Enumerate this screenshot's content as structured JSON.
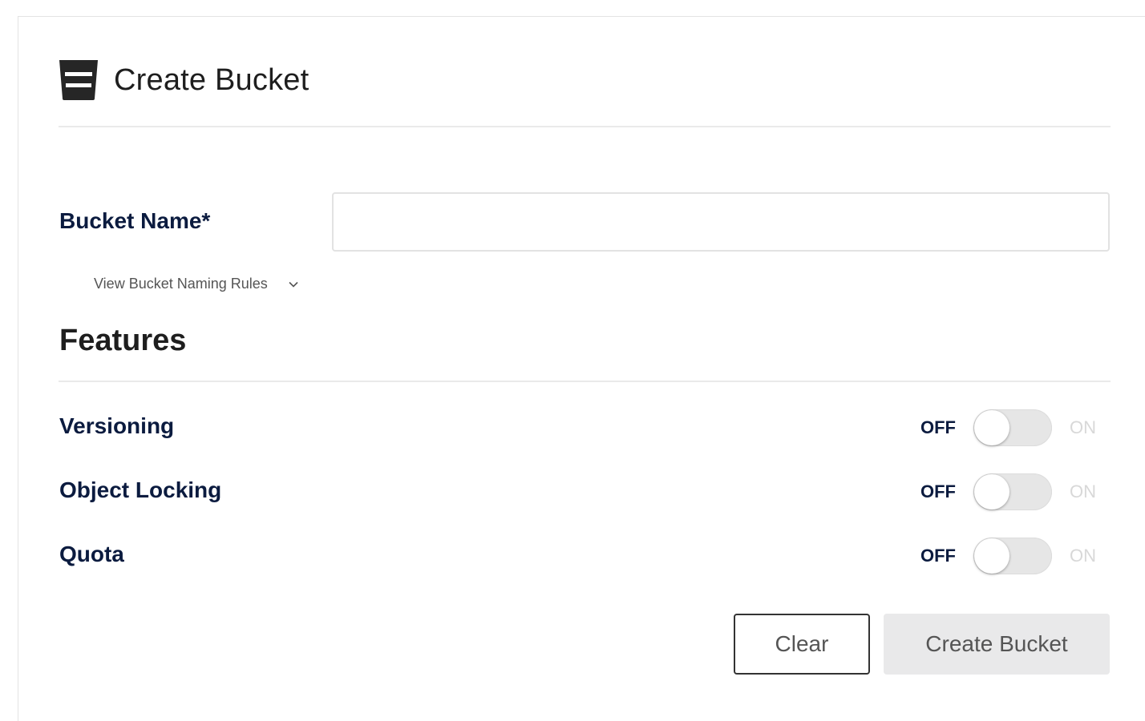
{
  "header": {
    "title": "Create Bucket",
    "icon": "bucket-icon"
  },
  "bucket_name": {
    "label": "Bucket Name*",
    "value": "",
    "placeholder": ""
  },
  "naming_rules": {
    "label": "View Bucket Naming Rules",
    "icon": "chevron-down-icon"
  },
  "features": {
    "title": "Features",
    "items": [
      {
        "label": "Versioning",
        "state": "OFF",
        "off_label": "OFF",
        "on_label": "ON"
      },
      {
        "label": "Object Locking",
        "state": "OFF",
        "off_label": "OFF",
        "on_label": "ON"
      },
      {
        "label": "Quota",
        "state": "OFF",
        "off_label": "OFF",
        "on_label": "ON"
      }
    ]
  },
  "actions": {
    "clear_label": "Clear",
    "create_label": "Create Bucket"
  },
  "colors": {
    "label_navy": "#0b1b3f",
    "disabled_button_bg": "#e9e9ea",
    "toggle_track": "#e6e6e6"
  }
}
